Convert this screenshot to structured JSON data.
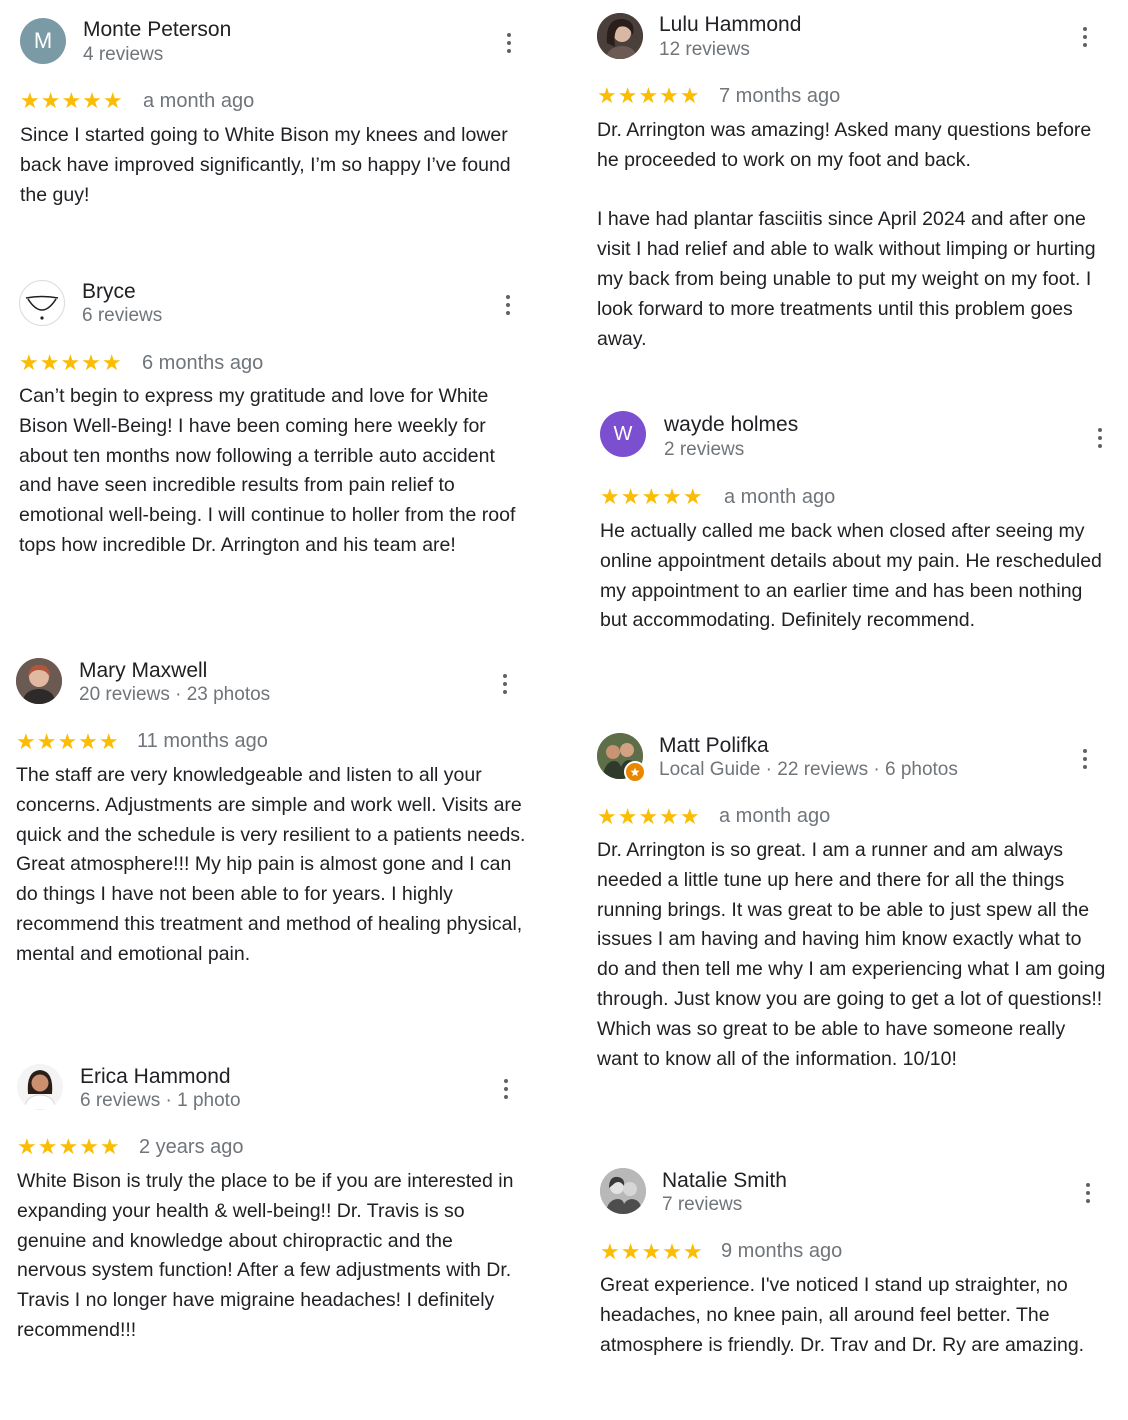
{
  "reviews": [
    {
      "name": "Monte Peterson",
      "meta": "4 reviews",
      "avatar_letter": "M",
      "avatar_color": "#7a9aa6",
      "rating": 5,
      "stars": "★★★★★",
      "date": "a month ago",
      "text": "Since I started going to White Bison my knees and lower back have improved significantly,   I’m so happy I’ve found the guy!"
    },
    {
      "name": "Bryce",
      "meta": "6 reviews",
      "avatar_icon": "person-outline-icon",
      "rating": 5,
      "stars": "★★★★★",
      "date": "6 months ago",
      "text": "Can’t begin to express my gratitude and love for White Bison Well-Being! I have been coming here weekly for about ten months now following a terrible auto accident and have seen incredible results from pain relief to emotional well-being. I will continue to holler from the roof tops how incredible Dr. Arrington and his team are!"
    },
    {
      "name": "Mary Maxwell",
      "meta": "20 reviews · 23 photos",
      "avatar_icon": "profile-photo-icon",
      "rating": 5,
      "stars": "★★★★★",
      "date": "11 months ago",
      "text": "The staff are very knowledgeable and listen to all your concerns.  Adjustments are simple and work well. Visits are quick and the schedule is very resilient to a patients needs. Great atmosphere!!!  My hip pain is almost gone and I can do things I have not been able to for years.  I highly recommend this treatment and method of healing physical, mental and emotional pain."
    },
    {
      "name": "Erica Hammond",
      "meta": "6 reviews · 1 photo",
      "avatar_icon": "profile-photo-icon",
      "rating": 5,
      "stars": "★★★★★",
      "date": "2 years ago",
      "text": "White Bison is truly the place to be if you are interested in expanding your health & well-being!! Dr. Travis is so genuine and knowledge about chiropractic and the nervous system function! After a few adjustments with Dr. Travis I no longer have migraine headaches! I definitely recommend!!!"
    },
    {
      "name": "Lulu Hammond",
      "meta": "12 reviews",
      "avatar_icon": "profile-photo-icon",
      "rating": 5,
      "stars": "★★★★★",
      "date": "7 months ago",
      "text": "Dr. Arrington was amazing!  Asked many questions before he proceeded to work on my foot and back.\n\nI have had plantar fasciitis since April 2024 and after one visit I had relief and able to walk without limping or hurting my back from being unable to put my weight on my foot.  I look forward to more treatments until this problem goes away."
    },
    {
      "name": "wayde holmes",
      "meta": "2 reviews",
      "avatar_letter": "W",
      "avatar_color": "#7b4fd0",
      "rating": 5,
      "stars": "★★★★★",
      "date": "a month ago",
      "text": "He actually called me back when closed after seeing my online appointment details about my pain. He rescheduled my appointment to an earlier time and has been nothing but accommodating. Definitely recommend."
    },
    {
      "name": "Matt Polifka",
      "meta": "Local Guide · 22 reviews · 6 photos",
      "avatar_icon": "profile-photo-icon",
      "badge_icon": "local-guide-icon",
      "rating": 5,
      "stars": "★★★★★",
      "date": "a month ago",
      "text": "Dr. Arrington is so great. I am a runner and am always needed a little tune up here and there for all the things running brings. It was great to be able to just spew all the issues I am having and having him know exactly what to do and then tell me why I am experiencing what I am going through. Just know you are going to get a lot of questions!! Which was so great to be able to have someone really want to know all of the information. 10/10!"
    },
    {
      "name": "Natalie Smith",
      "meta": "7 reviews",
      "avatar_icon": "profile-photo-icon",
      "rating": 5,
      "stars": "★★★★★",
      "date": "9 months ago",
      "text": "Great experience.  I've noticed I stand up straighter, no headaches,  no knee pain,  all around feel better.  The atmosphere is friendly. Dr. Trav and Dr. Ry are amazing."
    }
  ]
}
